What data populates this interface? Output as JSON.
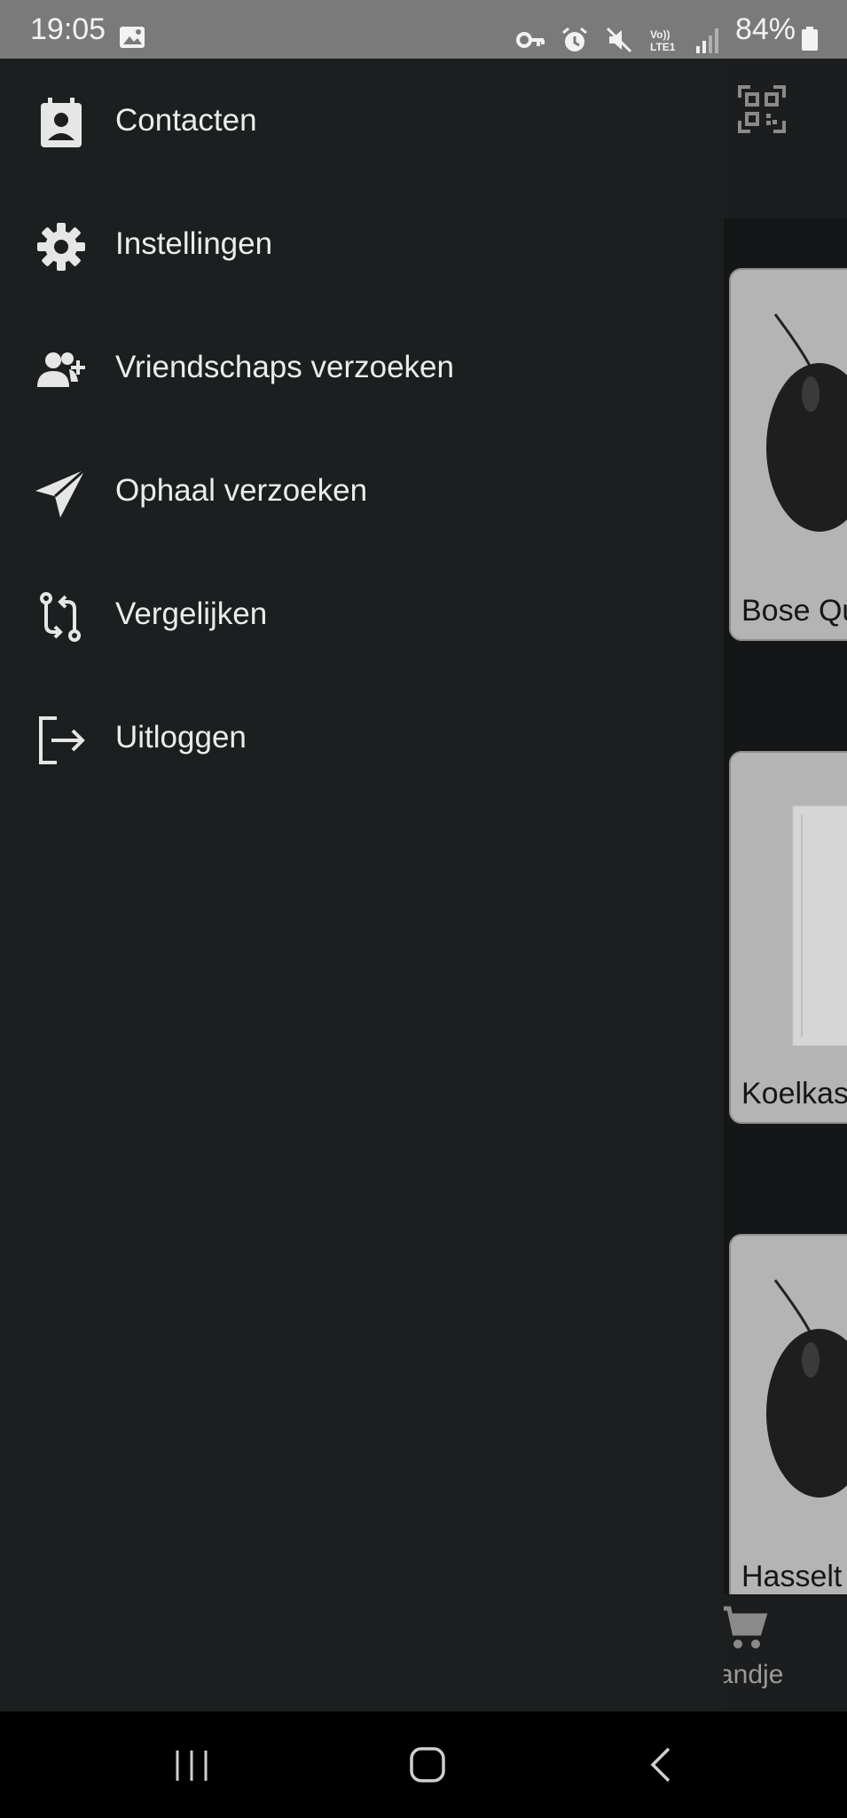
{
  "status_bar": {
    "time": "19:05",
    "battery": "84%",
    "icons": [
      "gallery-icon",
      "vpn-key-icon",
      "alarm-icon",
      "mute-icon",
      "volte-icon",
      "signal-icon",
      "battery-icon"
    ]
  },
  "drawer": {
    "items": [
      {
        "label": "Contacten",
        "icon": "contacts-icon"
      },
      {
        "label": "Instellingen",
        "icon": "gear-icon"
      },
      {
        "label": "Vriendschaps verzoeken",
        "icon": "add-user-icon"
      },
      {
        "label": "Ophaal verzoeken",
        "icon": "send-icon"
      },
      {
        "label": "Vergelijken",
        "icon": "compare-icon"
      },
      {
        "label": "Uitloggen",
        "icon": "logout-icon"
      }
    ]
  },
  "background": {
    "cards": [
      {
        "label": "Bose Qu"
      },
      {
        "label": "Koelkas"
      },
      {
        "label": "Hasselt"
      }
    ],
    "bottom_nav_label": "andje"
  },
  "colors": {
    "drawer_bg": "#1c1f20",
    "status_bar": "#7a7a7a",
    "card_bg": "#b4b4b4"
  }
}
